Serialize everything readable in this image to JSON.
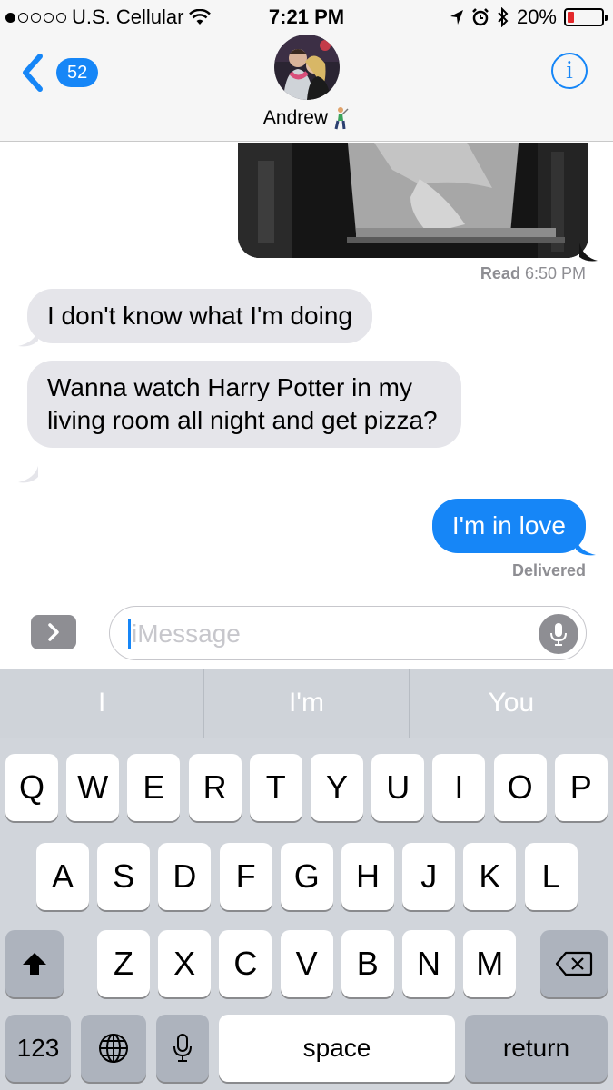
{
  "status_bar": {
    "carrier": "U.S. Cellular",
    "signal_bars_filled": 1,
    "signal_bars_total": 5,
    "time": "7:21 PM",
    "battery": "20%",
    "battery_level": 0.2,
    "battery_color": "#e3282b"
  },
  "nav": {
    "back_count": "52",
    "contact_name": "Andrew",
    "contact_emoji": "golfer-emoji",
    "info_label": "i"
  },
  "conversation": {
    "read_label": "Read",
    "read_time": "6:50 PM",
    "messages": [
      {
        "direction": "incoming",
        "text": "I don't know what I'm doing"
      },
      {
        "direction": "incoming",
        "text": "Wanna watch Harry Potter in my living room all night and get pizza?"
      },
      {
        "direction": "outgoing",
        "text": "I'm in love"
      }
    ],
    "delivered_label": "Delivered"
  },
  "input": {
    "placeholder": "iMessage",
    "expand_icon": "chevron-right-icon",
    "mic_icon": "microphone-icon"
  },
  "predictions": [
    "I",
    "I'm",
    "You"
  ],
  "keyboard": {
    "row1": [
      "Q",
      "W",
      "E",
      "R",
      "T",
      "Y",
      "U",
      "I",
      "O",
      "P"
    ],
    "row2": [
      "A",
      "S",
      "D",
      "F",
      "G",
      "H",
      "J",
      "K",
      "L"
    ],
    "row3": [
      "Z",
      "X",
      "C",
      "V",
      "B",
      "N",
      "M"
    ],
    "numbers_label": "123",
    "space_label": "space",
    "return_label": "return",
    "shift_icon": "shift-icon",
    "delete_icon": "backspace-icon",
    "globe_icon": "globe-icon",
    "dictation_icon": "microphone-icon"
  },
  "colors": {
    "accent": "#1686f7",
    "incoming_bubble": "#e5e5ea",
    "keyboard_bg": "#d1d5db"
  }
}
